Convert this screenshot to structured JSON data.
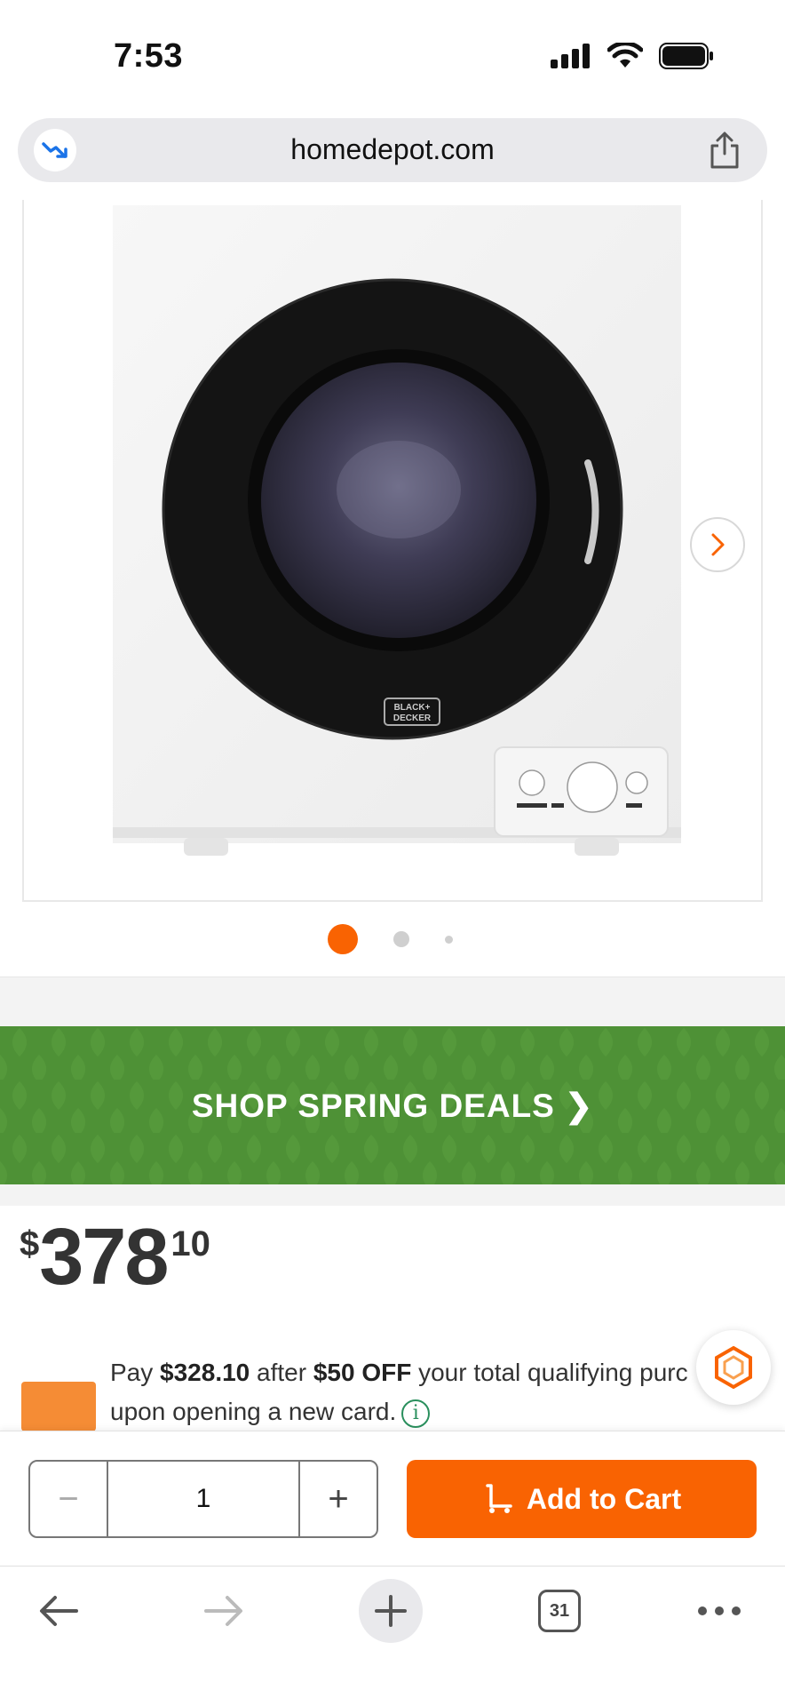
{
  "status_bar": {
    "time": "7:53"
  },
  "browser": {
    "url": "homedepot.com"
  },
  "gallery": {
    "brand_label_line1": "BLACK+",
    "brand_label_line2": "DECKER",
    "image_count": 3,
    "active_index": 0
  },
  "promo": {
    "text": "SHOP SPRING DEALS ❯",
    "color": "#4e9136"
  },
  "price": {
    "dollar_sign": "$",
    "dollars": "378",
    "cents": "10"
  },
  "financing": {
    "prefix": "Pay ",
    "amount": "$328.10",
    "middle": " after ",
    "discount": "$50 OFF",
    "suffix": " your total qualifying purc",
    "line2": "upon opening a new card.",
    "info_icon": "i"
  },
  "cart": {
    "minus": "−",
    "quantity": "1",
    "plus": "+",
    "add_label": "Add to Cart",
    "accent": "#f96302"
  },
  "toolbar": {
    "tabs_count": "31"
  }
}
